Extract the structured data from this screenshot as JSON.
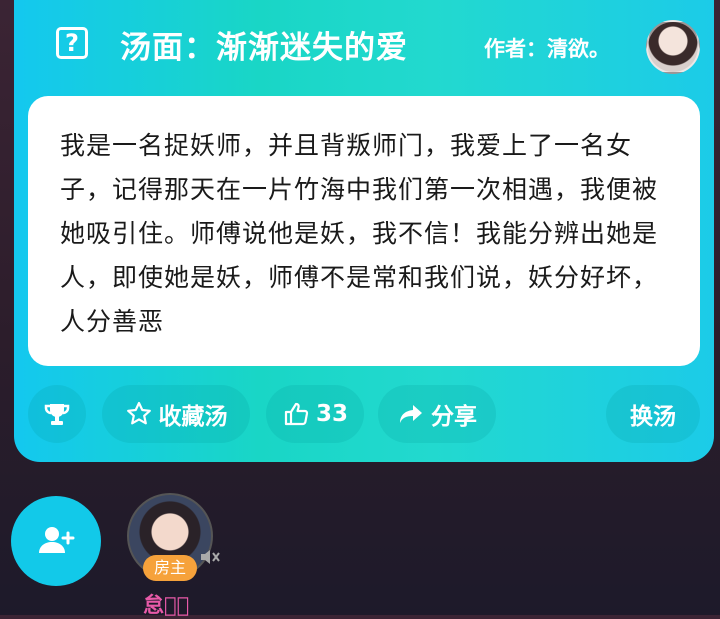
{
  "header": {
    "title": "汤面：渐渐迷失的爱",
    "author": "作者：清欲。",
    "help_icon": "question-box-icon"
  },
  "story": {
    "text": "我是一名捉妖师，并且背叛师门，我爱上了一名女子，记得那天在一片竹海中我们第一次相遇，我便被她吸引住。师傅说他是妖，我不信！我能分辨出她是人，即使她是妖，师傅不是常和我们说，妖分好坏，人分善恶"
  },
  "actions": {
    "collect_label": "收藏汤",
    "like_count": "33",
    "share_label": "分享",
    "change_label": "换汤"
  },
  "room": {
    "owner_badge": "房主",
    "owner_name": "怠月⃫"
  },
  "colors": {
    "card_start": "#14c8ef",
    "card_end": "#22d9cf",
    "owner_badge": "#f6a23b",
    "owner_name": "#e85aa8"
  }
}
